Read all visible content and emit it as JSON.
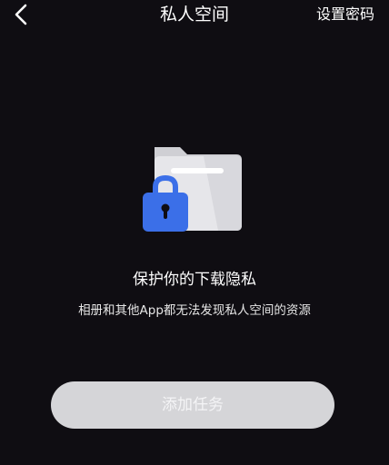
{
  "header": {
    "title": "私人空间",
    "action_label": "设置密码",
    "back_icon": "chevron-left-icon"
  },
  "main": {
    "illustration_icon": "locked-folder-icon",
    "headline": "保护你的下载隐私",
    "description": "相册和其他App都无法发现私人空间的资源",
    "add_task_label": "添加任务"
  },
  "colors": {
    "background": "#0f0d12",
    "lock_blue": "#3b6fe8",
    "folder_light": "#e4e4e8",
    "button_disabled": "#d5d5d8"
  }
}
